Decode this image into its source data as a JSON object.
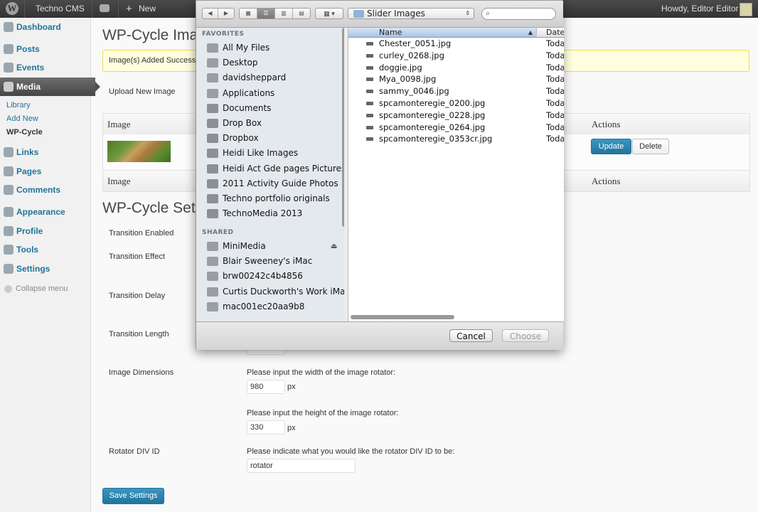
{
  "admin_bar": {
    "site_name": "Techno CMS",
    "new_label": "New",
    "greeting": "Howdy, Editor Editor"
  },
  "sidebar": {
    "items": [
      {
        "label": "Dashboard"
      },
      {
        "label": "Posts"
      },
      {
        "label": "Events"
      },
      {
        "label": "Media"
      },
      {
        "label": "Links"
      },
      {
        "label": "Pages"
      },
      {
        "label": "Comments"
      },
      {
        "label": "Appearance"
      },
      {
        "label": "Profile"
      },
      {
        "label": "Tools"
      },
      {
        "label": "Settings"
      }
    ],
    "media_submenu": [
      {
        "label": "Library"
      },
      {
        "label": "Add New"
      },
      {
        "label": "WP-Cycle"
      }
    ],
    "collapse_label": "Collapse menu"
  },
  "main": {
    "page_title": "WP-Cycle Imag",
    "notice": "Image(s) Added Successt",
    "upload_label": "Upload New Image",
    "table": {
      "col_image": "Image",
      "col_actions": "Actions",
      "update_label": "Update",
      "delete_label": "Delete"
    },
    "settings_title": "WP-Cycle Setti",
    "settings": {
      "transition_enabled": "Transition Enabled",
      "transition_effect": "Transition Effect",
      "transition_delay": "Transition Delay",
      "transition_length": "Transition Length",
      "image_dimensions": "Image Dimensions",
      "width_prompt": "Please input the width of the image rotator:",
      "width_value": "980",
      "height_prompt": "Please input the height of the image rotator:",
      "height_value": "330",
      "unit_px": "px",
      "rotator_div_id": "Rotator DIV ID",
      "div_prompt": "Please indicate what you would like the rotator DIV ID to be:",
      "div_value": "rotator",
      "save_label": "Save Settings"
    }
  },
  "dialog": {
    "location": "Slider Images",
    "favorites_heading": "FAVORITES",
    "favorites": [
      "All My Files",
      "Desktop",
      "davidsheppard",
      "Applications",
      "Documents",
      "Drop Box",
      "Dropbox",
      "Heidi Like Images",
      "Heidi Act Gde pages Pictures",
      "2011 Activity Guide Photos",
      "Techno portfolio originals",
      "TechnoMedia 2013"
    ],
    "shared_heading": "SHARED",
    "shared": [
      "MiniMedia",
      "Blair Sweeney's iMac",
      "brw00242c4b4856",
      "Curtis Duckworth's Work iMac",
      "mac001ec20aa9b8"
    ],
    "col_name": "Name",
    "col_date": "Date",
    "files": [
      {
        "name": "Chester_0051.jpg",
        "date": "Toda"
      },
      {
        "name": "curley_0268.jpg",
        "date": "Toda"
      },
      {
        "name": "doggie.jpg",
        "date": "Toda"
      },
      {
        "name": "Mya_0098.jpg",
        "date": "Toda"
      },
      {
        "name": "sammy_0046.jpg",
        "date": "Toda"
      },
      {
        "name": "spcamonteregie_0200.jpg",
        "date": "Toda"
      },
      {
        "name": "spcamonteregie_0228.jpg",
        "date": "Toda"
      },
      {
        "name": "spcamonteregie_0264.jpg",
        "date": "Toda"
      },
      {
        "name": "spcamonteregie_0353cr.jpg",
        "date": "Toda"
      }
    ],
    "cancel_label": "Cancel",
    "choose_label": "Choose"
  }
}
